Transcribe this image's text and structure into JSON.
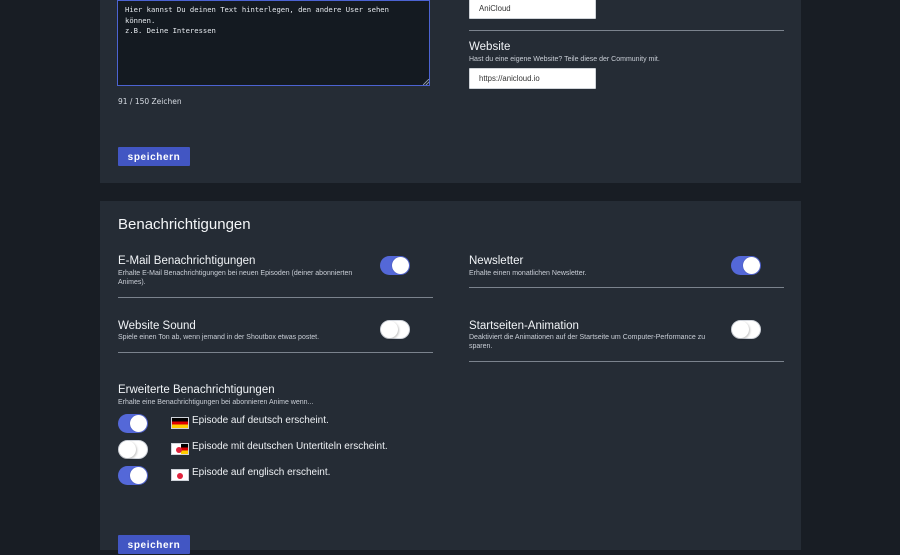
{
  "profile": {
    "bio_text": "Hier kannst Du deinen Text hinterlegen, den andere User sehen können.\nz.B. Deine Interessen",
    "char_count": "91 / 150 Zeichen",
    "save_label": "speichern",
    "name_value": "AniCloud",
    "website": {
      "title": "Website",
      "description": "Hast du eine eigene Website? Teile diese der Community mit.",
      "value": "https://anicloud.io"
    }
  },
  "notifications": {
    "title": "Benachrichtigungen",
    "save_label": "speichern",
    "settings": [
      {
        "title": "E-Mail Benachrichtigungen",
        "description": "Erhalte E-Mail Benachrichtigungen bei neuen Episoden (deiner abonnierten Animes).",
        "enabled": true
      },
      {
        "title": "Newsletter",
        "description": "Erhalte einen monatlichen Newsletter.",
        "enabled": true
      },
      {
        "title": "Website Sound",
        "description": "Spiele einen Ton ab, wenn jemand in der Shoutbox etwas postet.",
        "enabled": false
      },
      {
        "title": "Startseiten-Animation",
        "description": "Deaktiviert die Animationen auf der Startseite um Computer-Performance zu sparen.",
        "enabled": false
      }
    ],
    "advanced": {
      "title": "Erweiterte Benachrichtigungen",
      "description": "Erhalte eine Benachrichtigungen bei abonnieren Anime wenn...",
      "options": [
        {
          "label": "Episode auf deutsch erscheint.",
          "flag_icon": "german-flag-icon",
          "enabled": true
        },
        {
          "label": "Episode mit deutschen Untertiteln erscheint.",
          "flag_icon": "german-japanese-flag-icon",
          "enabled": false
        },
        {
          "label": "Episode auf englisch erscheint.",
          "flag_icon": "japanese-flag-icon",
          "enabled": true
        }
      ]
    }
  },
  "colors": {
    "background": "#181d24",
    "panel": "#252c35",
    "accent": "#5468d8",
    "button": "#4256c3"
  }
}
